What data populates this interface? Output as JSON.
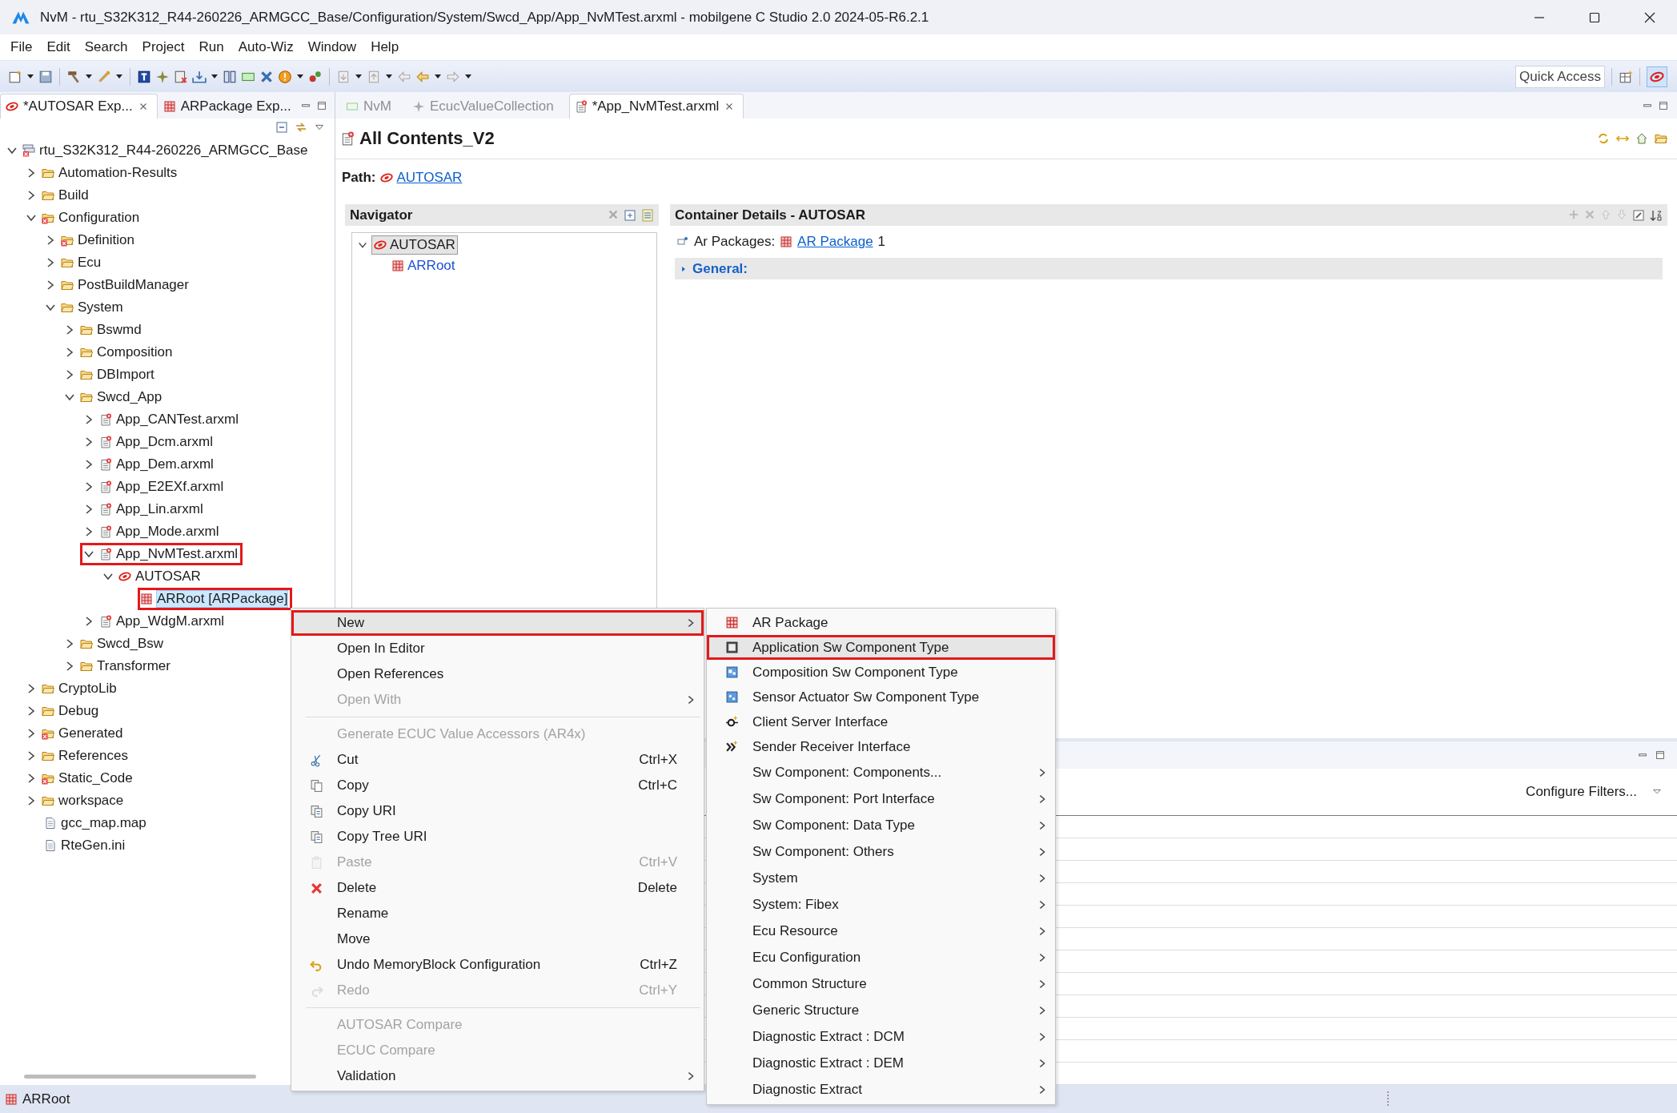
{
  "window": {
    "title": "NvM - rtu_S32K312_R44-260226_ARMGCC_Base/Configuration/System/Swcd_App/App_NvMTest.arxml - mobilgene C Studio 2.0 2024-05-R6.2.1"
  },
  "menu_bar": [
    "File",
    "Edit",
    "Search",
    "Project",
    "Run",
    "Auto-Wiz",
    "Window",
    "Help"
  ],
  "toolbar": {
    "quick_access": {
      "placeholder": "Quick Access"
    }
  },
  "explorer": {
    "tabs": [
      {
        "label": "*AUTOSAR Exp...",
        "selected": true,
        "closable": true
      },
      {
        "label": "ARPackage Exp...",
        "selected": false,
        "closable": false
      }
    ],
    "tree": [
      {
        "label": "rtu_S32K312_R44-260226_ARMGCC_Base",
        "kind": "project",
        "expanded": true,
        "selected": false,
        "outlined": false,
        "children": [
          {
            "label": "Automation-Results",
            "kind": "folder",
            "expanded": false,
            "selected": false,
            "outlined": false
          },
          {
            "label": "Build",
            "kind": "folder",
            "expanded": false,
            "selected": false,
            "outlined": false
          },
          {
            "label": "Configuration",
            "kind": "folder-error",
            "expanded": true,
            "selected": false,
            "outlined": false,
            "children": [
              {
                "label": "Definition",
                "kind": "folder-error",
                "expanded": false,
                "selected": false,
                "outlined": false
              },
              {
                "label": "Ecu",
                "kind": "folder",
                "expanded": false,
                "selected": false,
                "outlined": false
              },
              {
                "label": "PostBuildManager",
                "kind": "folder",
                "expanded": false,
                "selected": false,
                "outlined": false
              },
              {
                "label": "System",
                "kind": "folder",
                "expanded": true,
                "selected": false,
                "outlined": false,
                "children": [
                  {
                    "label": "Bswmd",
                    "kind": "folder",
                    "expanded": false,
                    "selected": false,
                    "outlined": false
                  },
                  {
                    "label": "Composition",
                    "kind": "folder",
                    "expanded": false,
                    "selected": false,
                    "outlined": false
                  },
                  {
                    "label": "DBImport",
                    "kind": "folder",
                    "expanded": false,
                    "selected": false,
                    "outlined": false
                  },
                  {
                    "label": "Swcd_App",
                    "kind": "folder",
                    "expanded": true,
                    "selected": false,
                    "outlined": false,
                    "children": [
                      {
                        "label": "App_CANTest.arxml",
                        "kind": "arxml",
                        "expanded": false,
                        "selected": false,
                        "outlined": false
                      },
                      {
                        "label": "App_Dcm.arxml",
                        "kind": "arxml",
                        "expanded": false,
                        "selected": false,
                        "outlined": false
                      },
                      {
                        "label": "App_Dem.arxml",
                        "kind": "arxml",
                        "expanded": false,
                        "selected": false,
                        "outlined": false
                      },
                      {
                        "label": "App_E2EXf.arxml",
                        "kind": "arxml",
                        "expanded": false,
                        "selected": false,
                        "outlined": false
                      },
                      {
                        "label": "App_Lin.arxml",
                        "kind": "arxml",
                        "expanded": false,
                        "selected": false,
                        "outlined": false
                      },
                      {
                        "label": "App_Mode.arxml",
                        "kind": "arxml",
                        "expanded": false,
                        "selected": false,
                        "outlined": false
                      },
                      {
                        "label": "App_NvMTest.arxml",
                        "kind": "arxml",
                        "expanded": true,
                        "selected": false,
                        "outlined": true,
                        "children": [
                          {
                            "label": "AUTOSAR",
                            "kind": "autosar",
                            "expanded": true,
                            "selected": false,
                            "outlined": false,
                            "children": [
                              {
                                "label": "ARRoot [ARPackage]",
                                "kind": "package",
                                "selected": true,
                                "outlined": true
                              }
                            ]
                          }
                        ]
                      },
                      {
                        "label": "App_WdgM.arxml",
                        "kind": "arxml",
                        "expanded": false,
                        "selected": false,
                        "outlined": false
                      }
                    ]
                  },
                  {
                    "label": "Swcd_Bsw",
                    "kind": "folder",
                    "expanded": false,
                    "selected": false,
                    "outlined": false
                  },
                  {
                    "label": "Transformer",
                    "kind": "folder",
                    "expanded": false,
                    "selected": false,
                    "outlined": false
                  }
                ]
              }
            ]
          },
          {
            "label": "CryptoLib",
            "kind": "folder",
            "expanded": false,
            "selected": false,
            "outlined": false
          },
          {
            "label": "Debug",
            "kind": "folder",
            "expanded": false,
            "selected": false,
            "outlined": false
          },
          {
            "label": "Generated",
            "kind": "folder-error",
            "expanded": false,
            "selected": false,
            "outlined": false
          },
          {
            "label": "References",
            "kind": "folder",
            "expanded": false,
            "selected": false,
            "outlined": false
          },
          {
            "label": "Static_Code",
            "kind": "folder-error",
            "expanded": false,
            "selected": false,
            "outlined": false
          },
          {
            "label": "workspace",
            "kind": "folder",
            "expanded": false,
            "selected": false,
            "outlined": false
          },
          {
            "label": "gcc_map.map",
            "kind": "file",
            "selected": false,
            "outlined": false
          },
          {
            "label": "RteGen.ini",
            "kind": "file",
            "selected": false,
            "outlined": false
          }
        ]
      }
    ]
  },
  "editor": {
    "tabs": [
      {
        "label": "NvM",
        "kind": "module",
        "selected": false,
        "closable": false
      },
      {
        "label": "EcucValueCollection",
        "kind": "collection",
        "selected": false,
        "closable": false
      },
      {
        "label": "*App_NvMTest.arxml",
        "kind": "arxml",
        "selected": true,
        "closable": true
      }
    ],
    "title": "All Contents_V2",
    "path_label": "Path:",
    "path_link": "AUTOSAR",
    "navigator": {
      "title": "Navigator",
      "tree": [
        {
          "label": "AUTOSAR",
          "kind": "autosar",
          "expanded": true,
          "selected": true,
          "children": [
            {
              "label": "ARRoot",
              "kind": "package",
              "selected": false
            }
          ]
        }
      ]
    },
    "details": {
      "title": "Container Details - AUTOSAR",
      "field_label": "Ar Packages:",
      "link": "AR Package",
      "count": "1",
      "section": "General:",
      "section_expanded": false
    }
  },
  "bottom_panel": {
    "filter_button": "Configure Filters..."
  },
  "context_menu": {
    "items": [
      {
        "kind": "item",
        "label": "New",
        "submenu": true,
        "disabled": false,
        "highlighted": true,
        "outlined": true
      },
      {
        "kind": "item",
        "label": "Open In Editor",
        "submenu": false,
        "disabled": false,
        "highlighted": false,
        "outlined": false
      },
      {
        "kind": "item",
        "label": "Open References",
        "submenu": false,
        "disabled": false,
        "highlighted": false,
        "outlined": false
      },
      {
        "kind": "item",
        "label": "Open With",
        "submenu": true,
        "disabled": true,
        "highlighted": false,
        "outlined": false
      },
      {
        "kind": "separator"
      },
      {
        "kind": "item",
        "label": "Generate ECUC Value Accessors (AR4x)",
        "submenu": false,
        "disabled": true,
        "highlighted": false,
        "outlined": false
      },
      {
        "kind": "item",
        "label": "Cut",
        "shortcut": "Ctrl+X",
        "submenu": false,
        "disabled": false,
        "highlighted": false,
        "outlined": false
      },
      {
        "kind": "item",
        "label": "Copy",
        "shortcut": "Ctrl+C",
        "submenu": false,
        "disabled": false,
        "highlighted": false,
        "outlined": false
      },
      {
        "kind": "item",
        "label": "Copy URI",
        "submenu": false,
        "disabled": false,
        "highlighted": false,
        "outlined": false
      },
      {
        "kind": "item",
        "label": "Copy Tree URI",
        "submenu": false,
        "disabled": false,
        "highlighted": false,
        "outlined": false
      },
      {
        "kind": "item",
        "label": "Paste",
        "shortcut": "Ctrl+V",
        "submenu": false,
        "disabled": true,
        "highlighted": false,
        "outlined": false
      },
      {
        "kind": "item",
        "label": "Delete",
        "shortcut": "Delete",
        "submenu": false,
        "disabled": false,
        "highlighted": false,
        "outlined": false
      },
      {
        "kind": "item",
        "label": "Rename",
        "submenu": false,
        "disabled": false,
        "highlighted": false,
        "outlined": false
      },
      {
        "kind": "item",
        "label": "Move",
        "submenu": false,
        "disabled": false,
        "highlighted": false,
        "outlined": false
      },
      {
        "kind": "item",
        "label": "Undo MemoryBlock Configuration",
        "shortcut": "Ctrl+Z",
        "submenu": false,
        "disabled": false,
        "highlighted": false,
        "outlined": false
      },
      {
        "kind": "item",
        "label": "Redo",
        "shortcut": "Ctrl+Y",
        "submenu": false,
        "disabled": true,
        "highlighted": false,
        "outlined": false
      },
      {
        "kind": "separator"
      },
      {
        "kind": "item",
        "label": "AUTOSAR Compare",
        "submenu": false,
        "disabled": true,
        "highlighted": false,
        "outlined": false
      },
      {
        "kind": "item",
        "label": "ECUC Compare",
        "submenu": false,
        "disabled": true,
        "highlighted": false,
        "outlined": false
      },
      {
        "kind": "item",
        "label": "Validation",
        "submenu": true,
        "disabled": false,
        "highlighted": false,
        "outlined": false
      }
    ]
  },
  "submenu": {
    "items": [
      {
        "kind": "item",
        "label": "AR Package",
        "submenu": false,
        "disabled": false,
        "highlighted": false,
        "outlined": false
      },
      {
        "kind": "item",
        "label": "Application Sw Component Type",
        "submenu": false,
        "disabled": false,
        "highlighted": true,
        "outlined": true
      },
      {
        "kind": "item",
        "label": "Composition Sw Component Type",
        "submenu": false,
        "disabled": false,
        "highlighted": false,
        "outlined": false
      },
      {
        "kind": "item",
        "label": "Sensor Actuator Sw Component Type",
        "submenu": false,
        "disabled": false,
        "highlighted": false,
        "outlined": false
      },
      {
        "kind": "item",
        "label": "Client Server Interface",
        "submenu": false,
        "disabled": false,
        "highlighted": false,
        "outlined": false
      },
      {
        "kind": "item",
        "label": "Sender Receiver Interface",
        "submenu": false,
        "disabled": false,
        "highlighted": false,
        "outlined": false
      },
      {
        "kind": "item",
        "label": "Sw Component: Components...",
        "submenu": true,
        "disabled": false,
        "highlighted": false,
        "outlined": false
      },
      {
        "kind": "item",
        "label": "Sw Component: Port Interface",
        "submenu": true,
        "disabled": false,
        "highlighted": false,
        "outlined": false
      },
      {
        "kind": "item",
        "label": "Sw Component: Data Type",
        "submenu": true,
        "disabled": false,
        "highlighted": false,
        "outlined": false
      },
      {
        "kind": "item",
        "label": "Sw Component: Others",
        "submenu": true,
        "disabled": false,
        "highlighted": false,
        "outlined": false
      },
      {
        "kind": "item",
        "label": "System",
        "submenu": true,
        "disabled": false,
        "highlighted": false,
        "outlined": false
      },
      {
        "kind": "item",
        "label": "System: Fibex",
        "submenu": true,
        "disabled": false,
        "highlighted": false,
        "outlined": false
      },
      {
        "kind": "item",
        "label": "Ecu Resource",
        "submenu": true,
        "disabled": false,
        "highlighted": false,
        "outlined": false
      },
      {
        "kind": "item",
        "label": "Ecu Configuration",
        "submenu": true,
        "disabled": false,
        "highlighted": false,
        "outlined": false
      },
      {
        "kind": "item",
        "label": "Common Structure",
        "submenu": true,
        "disabled": false,
        "highlighted": false,
        "outlined": false
      },
      {
        "kind": "item",
        "label": "Generic Structure",
        "submenu": true,
        "disabled": false,
        "highlighted": false,
        "outlined": false
      },
      {
        "kind": "item",
        "label": "Diagnostic Extract : DCM",
        "submenu": true,
        "disabled": false,
        "highlighted": false,
        "outlined": false
      },
      {
        "kind": "item",
        "label": "Diagnostic Extract : DEM",
        "submenu": true,
        "disabled": false,
        "highlighted": false,
        "outlined": false
      },
      {
        "kind": "item",
        "label": "Diagnostic Extract",
        "submenu": true,
        "disabled": false,
        "highlighted": false,
        "outlined": false
      }
    ]
  },
  "status_bar": {
    "text": "ARRoot"
  }
}
